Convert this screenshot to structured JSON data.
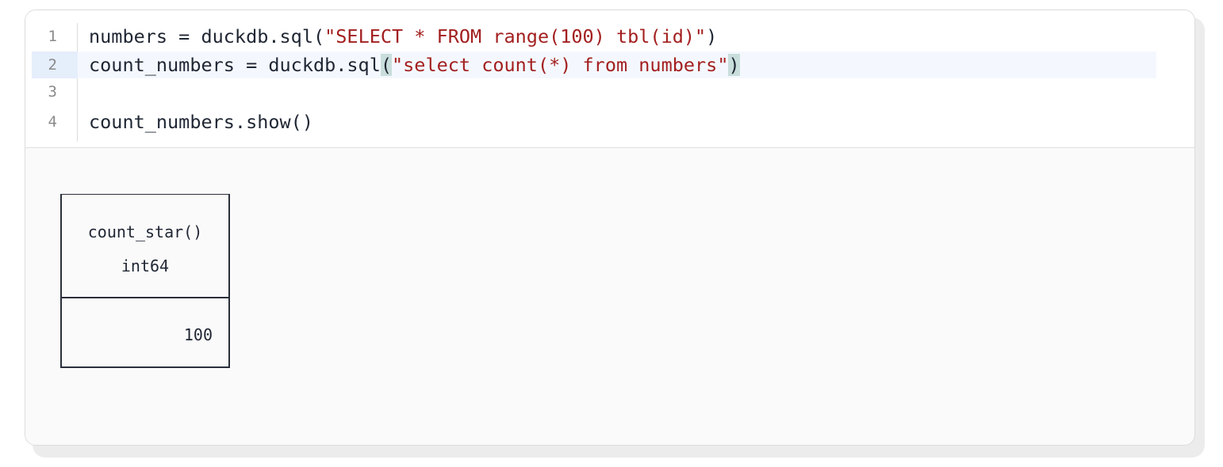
{
  "editor": {
    "lines": [
      {
        "number": "1",
        "parts": [
          "numbers = duckdb.sql(",
          "\"SELECT * FROM range(100) tbl(id)\"",
          ")"
        ]
      },
      {
        "number": "2",
        "parts": [
          "count_numbers = duckdb.sql",
          "(",
          "\"select count(*) from numbers\"",
          ")"
        ]
      },
      {
        "number": "3",
        "parts": [
          ""
        ]
      },
      {
        "number": "4",
        "parts": [
          "count_numbers.show()"
        ]
      }
    ]
  },
  "output": {
    "column_name": "count_star()",
    "column_type": "int64",
    "value": "100"
  },
  "colors": {
    "string": "#a31f1f",
    "active_line": "#f4f8fe",
    "bracket_match": "#c9dedc"
  }
}
